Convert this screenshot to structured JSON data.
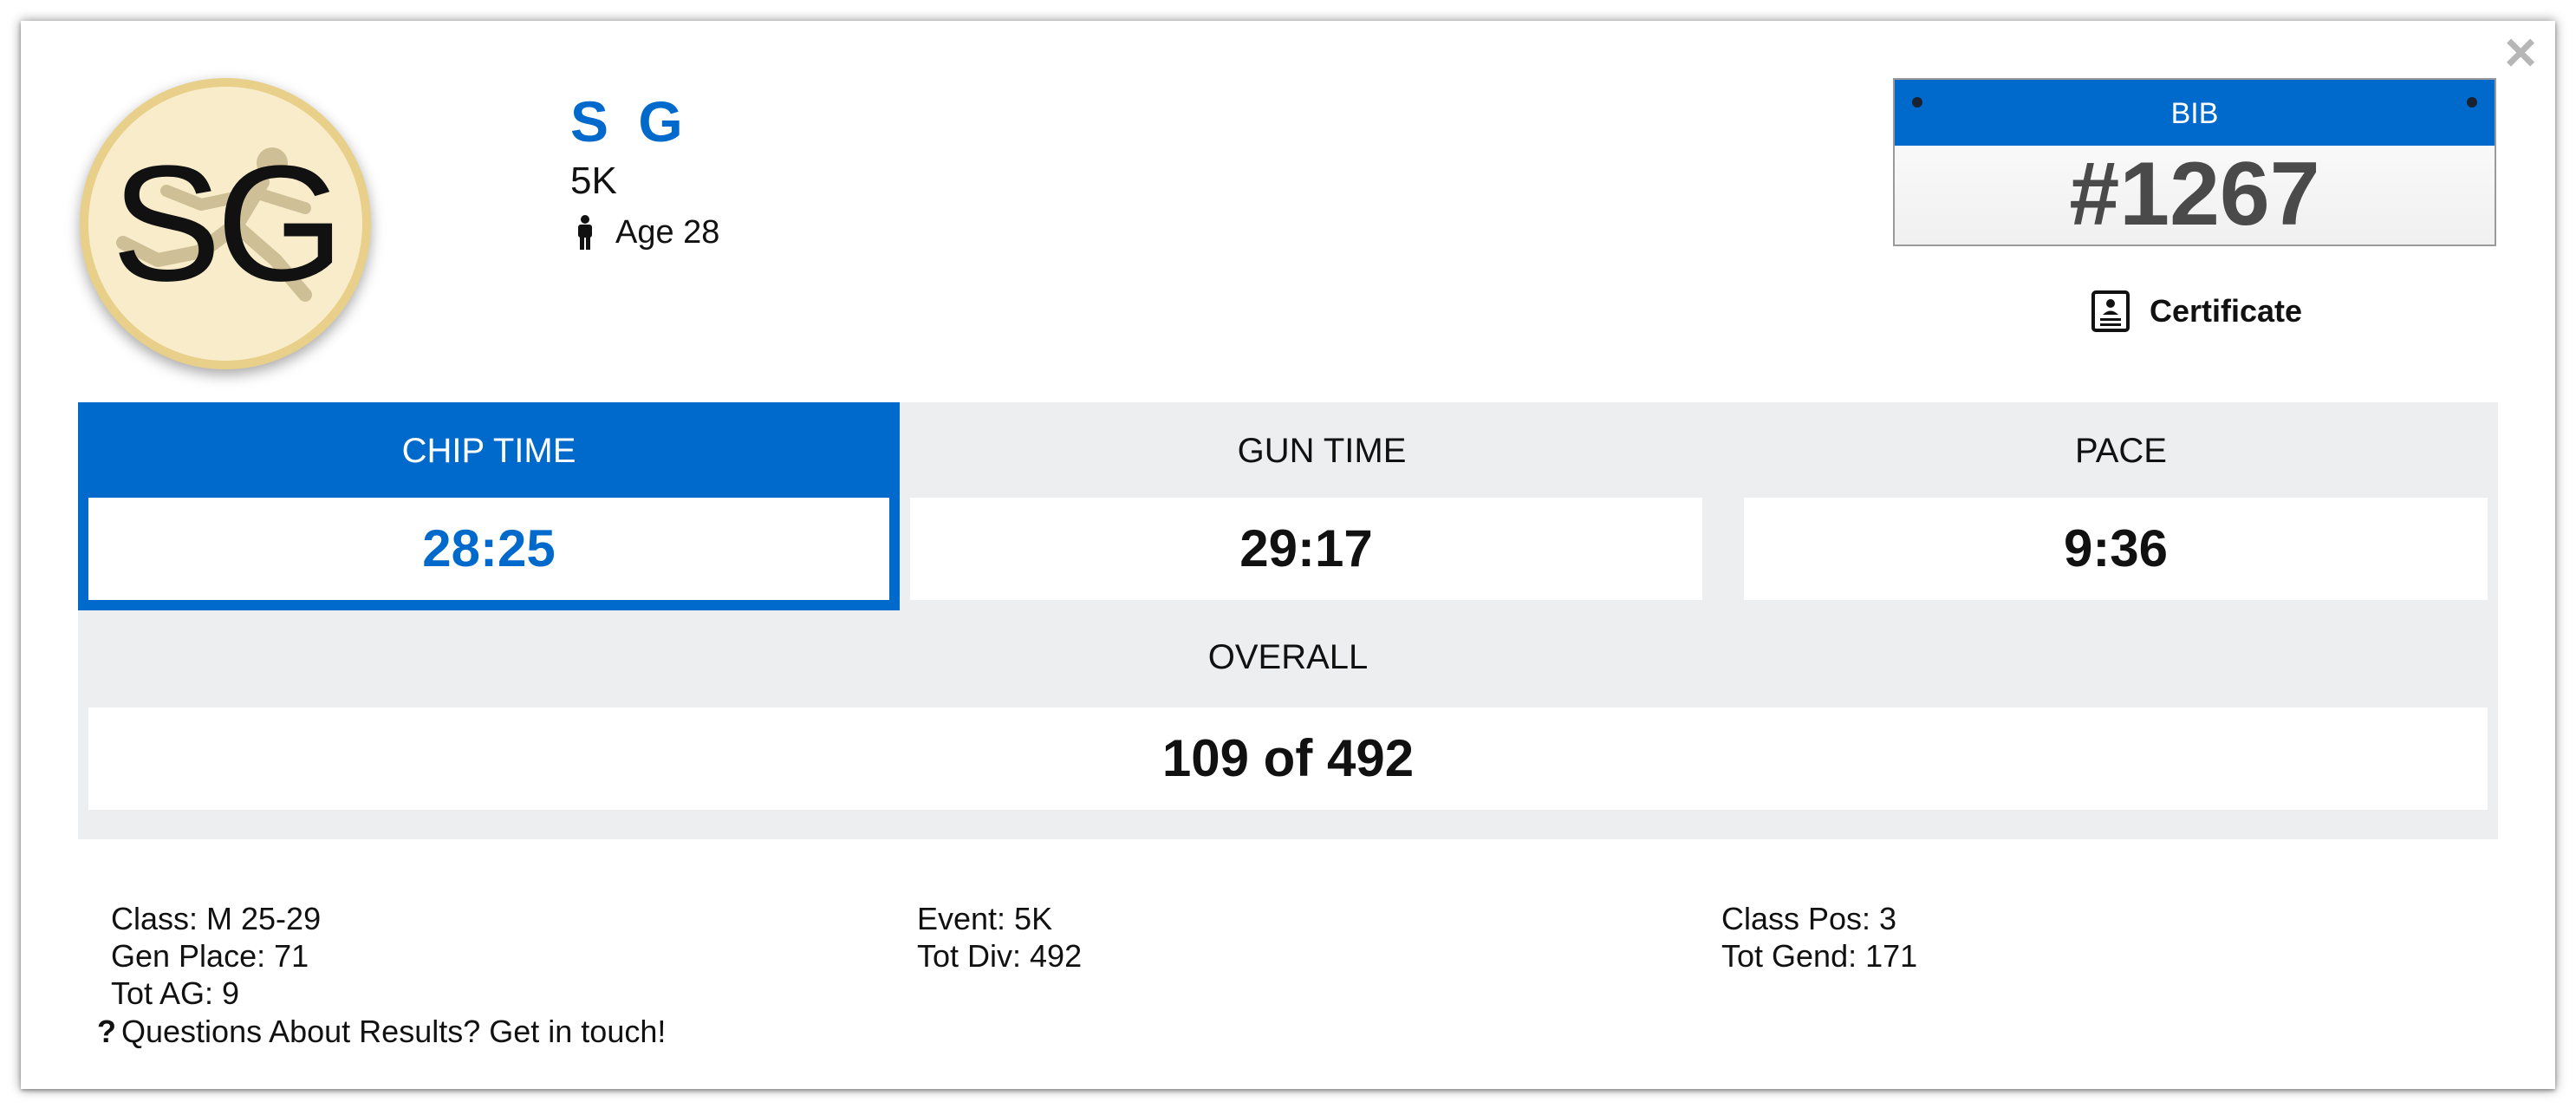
{
  "close_symbol": "×",
  "avatar": {
    "initials": "SG",
    "icon": "runner-icon",
    "colors": {
      "fill": "#f8ecca",
      "ring": "#e8d08a"
    }
  },
  "athlete": {
    "name": "S G",
    "event": "5K",
    "age_label": "Age 28",
    "gender_icon": "male-person-icon"
  },
  "bib": {
    "label": "BIB",
    "number": "#1267"
  },
  "certificate": {
    "label": "Certificate",
    "icon": "certificate-icon"
  },
  "stats": {
    "chip_time": {
      "label": "CHIP TIME",
      "value": "28:25"
    },
    "gun_time": {
      "label": "GUN TIME",
      "value": "29:17"
    },
    "pace": {
      "label": "PACE",
      "value": "9:36"
    },
    "overall": {
      "label": "OVERALL",
      "value": "109 of 492"
    }
  },
  "details": {
    "col1": [
      "Class: M 25-29",
      "Gen Place: 71",
      "Tot AG: 9"
    ],
    "col2": [
      "Event: 5K",
      "Tot Div: 492"
    ],
    "col3": [
      "Class Pos: 3",
      "Tot Gend: 171"
    ]
  },
  "questions": {
    "icon_symbol": "?",
    "text": "Questions About Results? Get in touch!"
  },
  "colors": {
    "accent": "#0069cc",
    "panel": "#eceef0",
    "text": "#111111",
    "bib_number": "#4a4a4a"
  }
}
